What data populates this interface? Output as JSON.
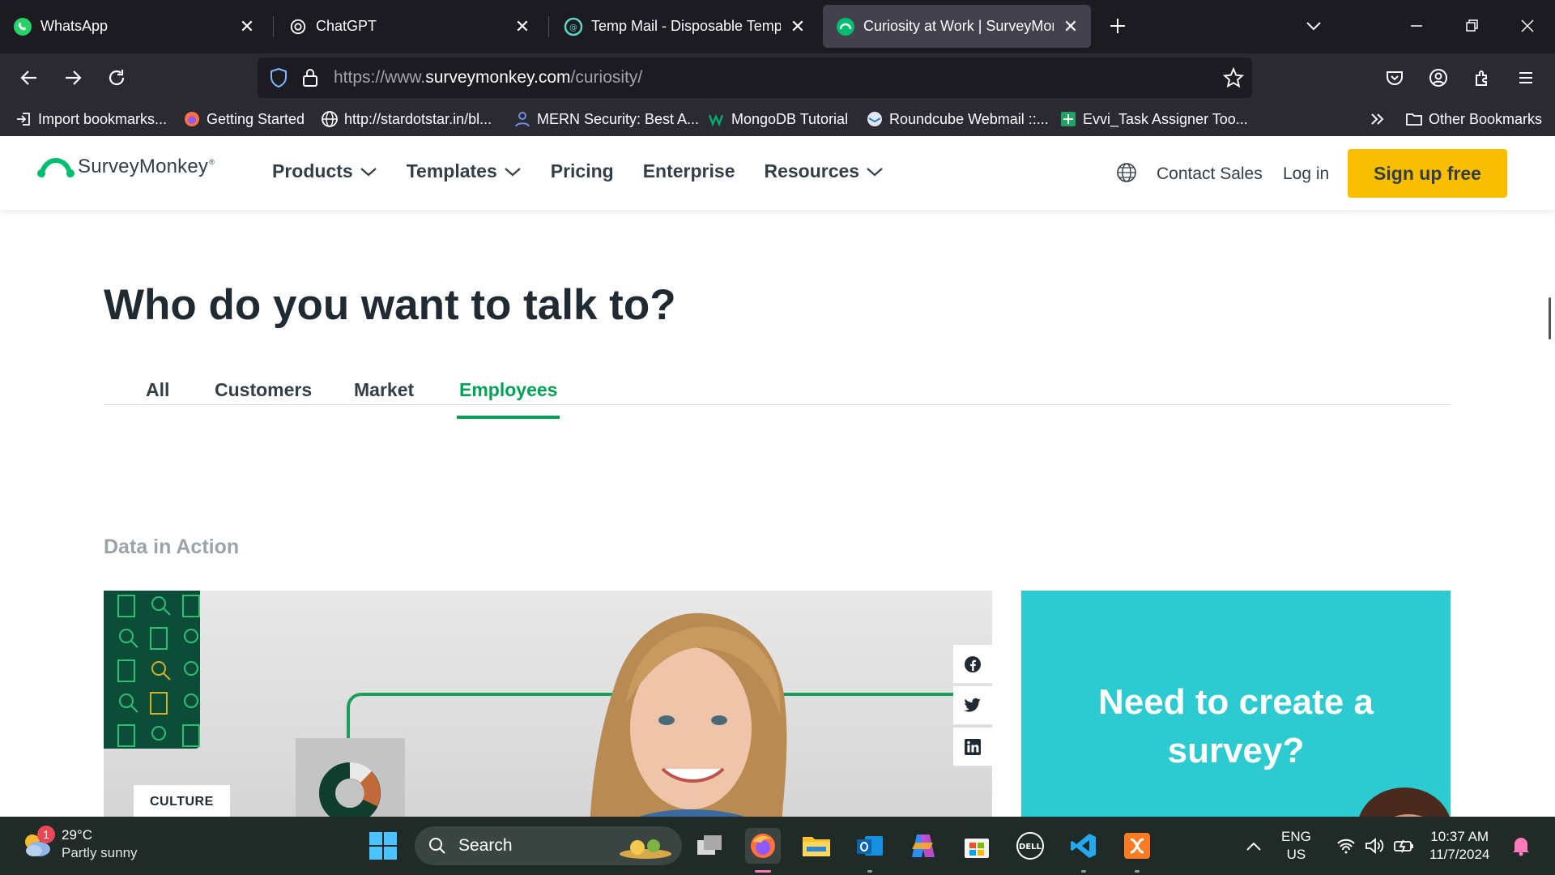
{
  "browser": {
    "tabs": [
      {
        "title": "WhatsApp",
        "icon": "whatsapp-icon",
        "active": false
      },
      {
        "title": "ChatGPT",
        "icon": "chatgpt-icon",
        "active": false
      },
      {
        "title": "Temp Mail - Disposable Tempo",
        "icon": "tempmail-icon",
        "active": false
      },
      {
        "title": "Curiosity at Work | SurveyMonk",
        "icon": "surveymonkey-icon",
        "active": true
      }
    ],
    "url_prefix": "https://www.",
    "url_domain": "surveymonkey.com",
    "url_path": "/curiosity/",
    "bookmarks": [
      {
        "label": "Import bookmarks...",
        "icon": "import-icon"
      },
      {
        "label": "Getting Started",
        "icon": "firefox-icon"
      },
      {
        "label": "http://stardotstar.in/bl...",
        "icon": "globe-icon"
      },
      {
        "label": "MERN Security: Best A...",
        "icon": "user-icon"
      },
      {
        "label": "MongoDB Tutorial",
        "icon": "w3-icon"
      },
      {
        "label": "Roundcube Webmail ::...",
        "icon": "roundcube-icon"
      },
      {
        "label": "Evvi_Task Assigner Too...",
        "icon": "sheets-icon"
      }
    ],
    "other_bookmarks": "Other Bookmarks"
  },
  "site": {
    "logo": "SurveyMonkey",
    "nav": [
      {
        "label": "Products",
        "dropdown": true
      },
      {
        "label": "Templates",
        "dropdown": true
      },
      {
        "label": "Pricing",
        "dropdown": false
      },
      {
        "label": "Enterprise",
        "dropdown": false
      },
      {
        "label": "Resources",
        "dropdown": true
      }
    ],
    "contact_sales": "Contact Sales",
    "login": "Log in",
    "signup": "Sign up free"
  },
  "main": {
    "heading": "Who do you want to talk to?",
    "tabs": [
      "All",
      "Customers",
      "Market",
      "Employees"
    ],
    "active_tab": "Employees",
    "section_label": "Data in Action",
    "card_badge": "CULTURE",
    "promo_title_line1": "Need to create a",
    "promo_title_line2": "survey?"
  },
  "taskbar": {
    "weather_temp": "29°C",
    "weather_cond": "Partly sunny",
    "weather_badge": "1",
    "search_placeholder": "Search",
    "lang_top": "ENG",
    "lang_bottom": "US",
    "time": "10:37 AM",
    "date": "11/7/2024"
  },
  "colors": {
    "brand_green": "#00a453",
    "signup_yellow": "#f9be00",
    "promo_teal": "#2ccbd2"
  }
}
